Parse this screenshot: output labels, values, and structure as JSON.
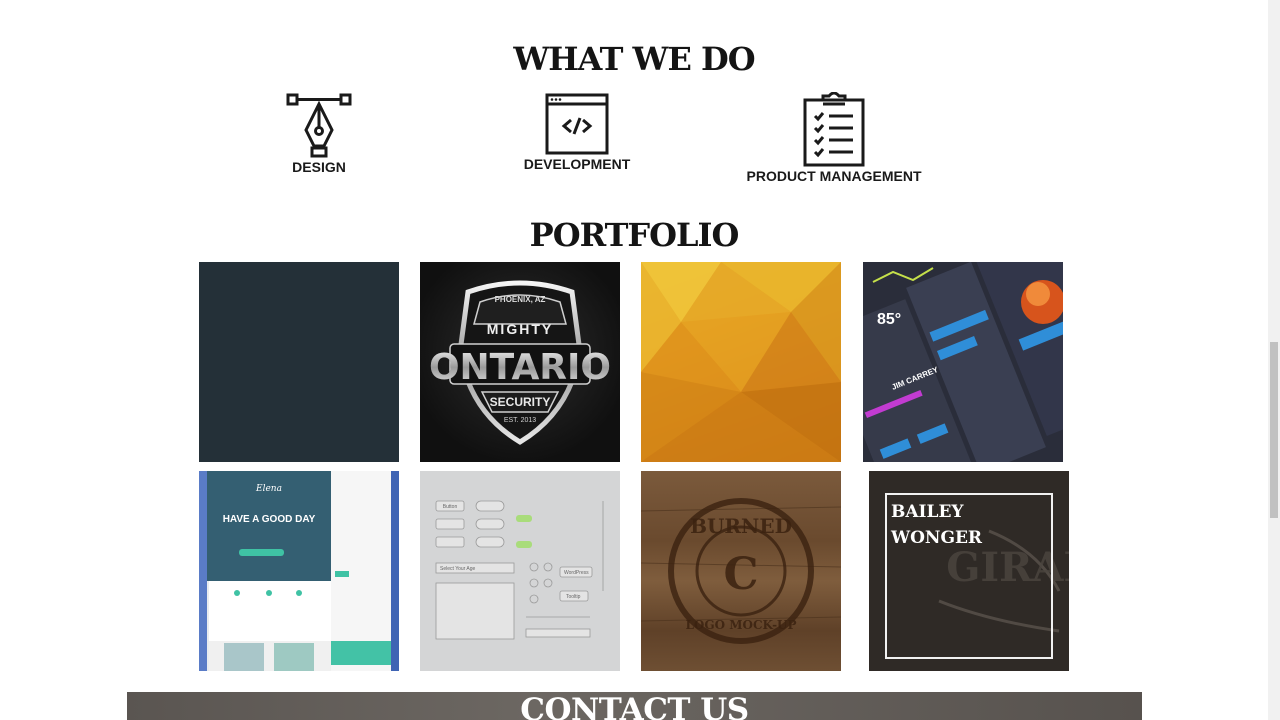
{
  "sections": {
    "what_we_do": {
      "title": "WHAT WE DO",
      "services": [
        {
          "label": "DESIGN",
          "icon": "pen-tool-icon"
        },
        {
          "label": "DEVELOPMENT",
          "icon": "code-window-icon"
        },
        {
          "label": "PRODUCT MANAGEMENT",
          "icon": "clipboard-checklist-icon"
        }
      ]
    },
    "portfolio": {
      "title": "PORTFOLIO",
      "tiles": [
        {
          "name": "portfolio-dark-tile"
        },
        {
          "name": "portfolio-ontario-logo",
          "texts": {
            "top": "PHOENIX, AZ",
            "mid1": "MIGHTY",
            "mid2": "ONTARIO",
            "sub": "SECURITY",
            "est": "EST. 2013"
          }
        },
        {
          "name": "portfolio-polygon-orange"
        },
        {
          "name": "portfolio-dark-ui-kit",
          "texts": {
            "temp": "85°",
            "name": "JIM CARREY"
          }
        },
        {
          "name": "portfolio-web-template",
          "texts": {
            "brand": "Elena",
            "headline": "HAVE A GOOD DAY"
          }
        },
        {
          "name": "portfolio-light-ui-kit",
          "texts": {
            "btn": "Button",
            "select": "Select Your Age",
            "wp": "WordPress",
            "tt": "Tooltip"
          }
        },
        {
          "name": "portfolio-burned-logo",
          "texts": {
            "top": "BURNED",
            "bottom": "LOGO MOCK-UP",
            "letter": "C"
          }
        },
        {
          "name": "portfolio-bailey-wonger",
          "texts": {
            "line1": "BAILEY",
            "line2": "WONGER"
          }
        }
      ]
    },
    "contact": {
      "title": "CONTACT US"
    }
  },
  "colors": {
    "heading": "#141414",
    "dark_tile": "#243038",
    "contact_bg": "#5f5a56"
  }
}
